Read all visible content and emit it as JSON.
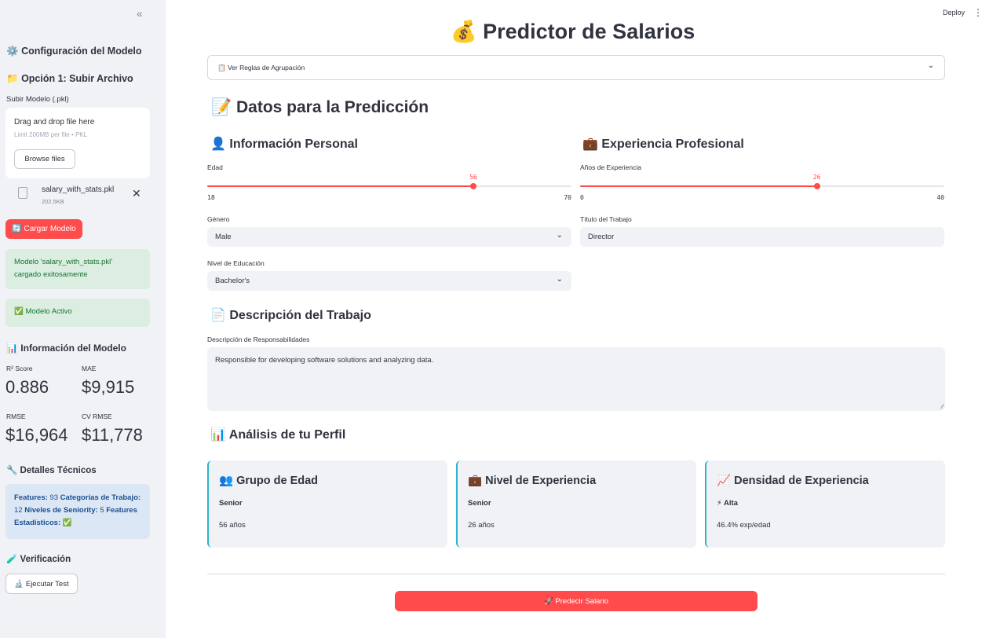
{
  "app": {
    "deploy_label": "Deploy",
    "menu_icon": "⋮"
  },
  "sidebar": {
    "collapse_icon": "«",
    "config_icon": "⚙️",
    "config_title": "Configuración del Modelo",
    "option1_icon": "📁",
    "option1_title": "Opción 1: Subir Archivo",
    "upload_label": "Subir Modelo (.pkl)",
    "drop_text": "Drag and drop file here",
    "limit_text": "Limit 200MB per file • PKL",
    "browse_label": "Browse files",
    "file_name": "salary_with_stats.pkl",
    "file_size": "202.5KB",
    "remove_icon": "✕",
    "load_label": "🔄 Cargar Modelo",
    "success_line1": "Modelo 'salary_with_stats.pkl'",
    "success_line2": "cargado exitosamente",
    "active_label": "✅ Modelo Activo",
    "info_icon": "📊",
    "info_title": "Información del Modelo",
    "metrics": {
      "r2_label": "R² Score",
      "r2_value": "0.886",
      "mae_label": "MAE",
      "mae_value": "$9,915",
      "rmse_label": "RMSE",
      "rmse_value": "$16,964",
      "cvrmse_label": "CV RMSE",
      "cvrmse_value": "$11,778"
    },
    "tech_icon": "🔧",
    "tech_title": "Detalles Técnicos",
    "tech": {
      "features_label": "Features:",
      "features_value": "93",
      "categories_label": "Categorías de Trabajo:",
      "categories_value": "12",
      "seniority_label": "Niveles de Seniority:",
      "seniority_value": "5",
      "stat_label": "Features Estadísticos:",
      "stat_value": "✅"
    },
    "verify_icon": "🧪",
    "verify_title": "Verificación",
    "test_label": "🔬 Ejecutar Test"
  },
  "main": {
    "title_icon": "💰",
    "title": "Predictor de Salarios",
    "expander_label": "📋 Ver Reglas de Agrupación",
    "data_icon": "📝",
    "data_title": "Datos para la Predicción",
    "personal_icon": "👤",
    "personal_title": "Información Personal",
    "experience_icon": "💼",
    "experience_title": "Experiencia Profesional",
    "age": {
      "label": "Edad",
      "value": 56,
      "min": 18,
      "max": 70
    },
    "years": {
      "label": "Años de Experiencia",
      "value": 26,
      "min": 0,
      "max": 40
    },
    "gender": {
      "label": "Género",
      "value": "Male"
    },
    "job_title": {
      "label": "Título del Trabajo",
      "value": "Director"
    },
    "education": {
      "label": "Nivel de Educación",
      "value": "Bachelor's"
    },
    "desc_icon": "📄",
    "desc_title": "Descripción del Trabajo",
    "desc_label": "Descripción de Responsabilidades",
    "desc_value": "Responsible for developing software solutions and analyzing data.",
    "analysis_icon": "📊",
    "analysis_title": "Análisis de tu Perfil",
    "cards": [
      {
        "icon": "👥",
        "title": "Grupo de Edad",
        "sub": "Senior",
        "note": "56 años"
      },
      {
        "icon": "💼",
        "title": "Nivel de Experiencia",
        "sub": "Senior",
        "note": "26 años"
      },
      {
        "icon": "📈",
        "title": "Densidad de Experiencia",
        "sub": "⚡ Alta",
        "note": "46.4% exp/edad"
      }
    ],
    "predict_label": "🚀 Predecir Salario",
    "accent_color": "#ff4b4b"
  }
}
